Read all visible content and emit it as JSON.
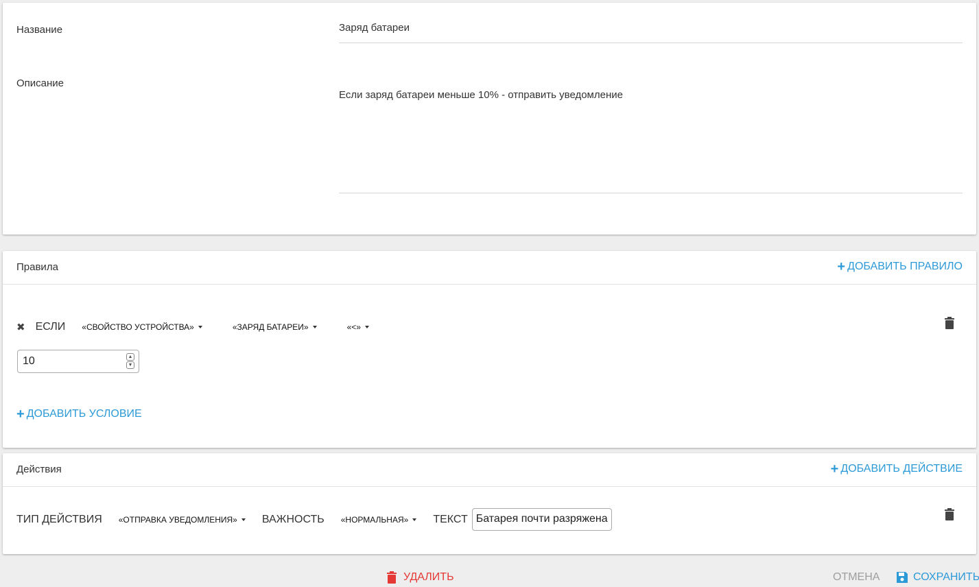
{
  "general": {
    "name_label": "Название",
    "name_value": "Заряд батареи",
    "description_label": "Описание",
    "description_value": "Если заряд батареи меньше 10% - отправить уведомление"
  },
  "rules": {
    "title": "Правила",
    "add_rule": "ДОБАВИТЬ ПРАВИЛО",
    "condition": {
      "if_label": "ЕСЛИ",
      "source": "«СВОЙСТВО УСТРОЙСТВА»",
      "property": "«ЗАРЯД БАТАРЕИ»",
      "operator": "«<»",
      "value": "10"
    },
    "add_condition": "ДОБАВИТЬ УСЛОВИЕ"
  },
  "actions": {
    "title": "Действия",
    "add_action": "ДОБАВИТЬ ДЕЙСТВИЕ",
    "action": {
      "type_label": "ТИП ДЕЙСТВИЯ",
      "type_value": "«ОТПРАВКА УВЕДОМЛЕНИЯ»",
      "severity_label": "ВАЖНОСТЬ",
      "severity_value": "«НОРМАЛЬНАЯ»",
      "text_label": "ТЕКСТ",
      "text_value": "Батарея почти разряжена"
    }
  },
  "footer": {
    "delete": "УДАЛИТЬ",
    "cancel": "ОТМЕНА",
    "save": "СОХРАНИТЬ"
  },
  "colors": {
    "accent": "#2d9ad8",
    "danger": "#e53935",
    "muted": "#9e9e9e"
  },
  "icons": {
    "add": "plus-icon",
    "remove_condition": "close-icon",
    "delete_rule": "trash-icon",
    "delete_action": "trash-icon",
    "delete": "trash-icon",
    "save": "floppy-disk-icon"
  }
}
